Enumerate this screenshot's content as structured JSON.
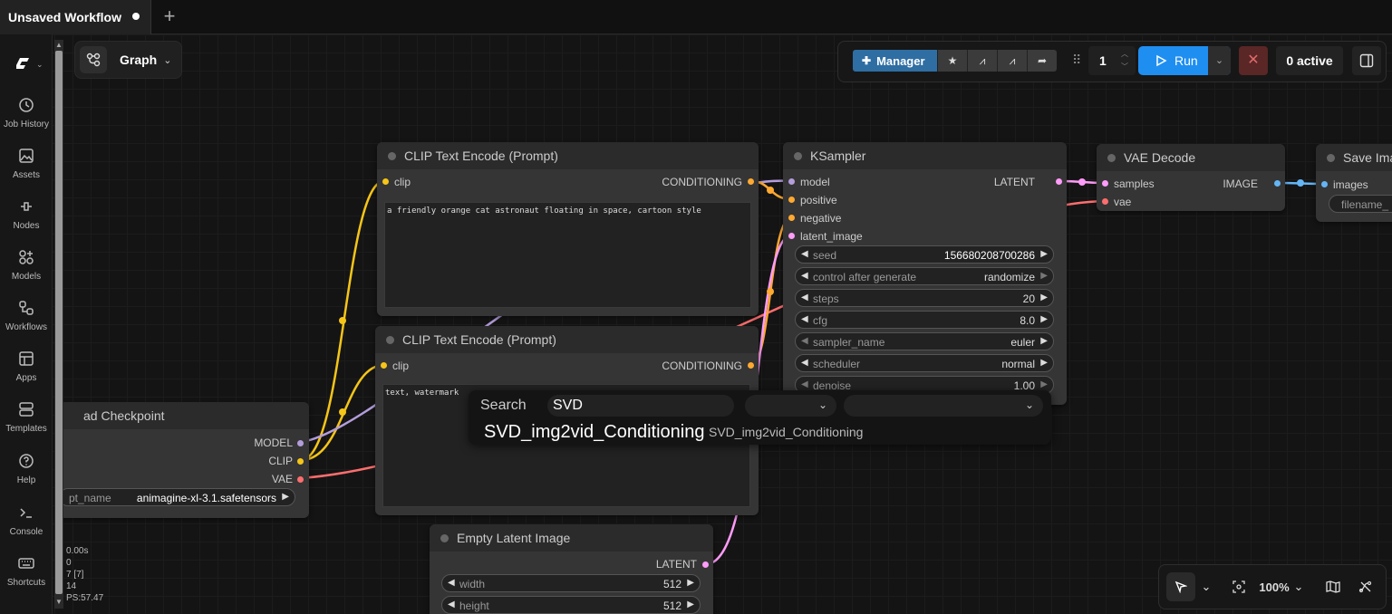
{
  "tab": {
    "title": "Unsaved Workflow"
  },
  "sidebar": {
    "items": [
      {
        "label": "Job History",
        "icon": "history-icon"
      },
      {
        "label": "Assets",
        "icon": "image-icon"
      },
      {
        "label": "Nodes",
        "icon": "nodes-icon"
      },
      {
        "label": "Models",
        "icon": "models-icon"
      },
      {
        "label": "Workflows",
        "icon": "workflows-icon"
      },
      {
        "label": "Apps",
        "icon": "apps-icon"
      },
      {
        "label": "Templates",
        "icon": "templates-icon"
      },
      {
        "label": "Help",
        "icon": "help-icon"
      },
      {
        "label": "Console",
        "icon": "terminal-icon"
      },
      {
        "label": "Shortcuts",
        "icon": "keyboard-icon"
      }
    ]
  },
  "graph": {
    "label": "Graph"
  },
  "toolbar": {
    "manager_label": "Manager",
    "queue_count": "1",
    "run_label": "Run",
    "active_label": "0 active"
  },
  "nodes": {
    "clip1": {
      "title": "CLIP Text Encode (Prompt)",
      "in_clip": "clip",
      "out": "CONDITIONING",
      "text": "a friendly orange cat astronaut floating in space, cartoon style"
    },
    "clip2": {
      "title": "CLIP Text Encode (Prompt)",
      "in_clip": "clip",
      "out": "CONDITIONING",
      "text": "text, watermark"
    },
    "ksampler": {
      "title": "KSampler",
      "inputs": [
        "model",
        "positive",
        "negative",
        "latent_image"
      ],
      "out": "LATENT",
      "widgets": [
        {
          "label": "seed",
          "value": "156680208700286"
        },
        {
          "label": "control after generate",
          "value": "randomize"
        },
        {
          "label": "steps",
          "value": "20"
        },
        {
          "label": "cfg",
          "value": "8.0"
        },
        {
          "label": "sampler_name",
          "value": "euler"
        },
        {
          "label": "scheduler",
          "value": "normal"
        },
        {
          "label": "denoise",
          "value": "1.00"
        }
      ]
    },
    "vae": {
      "title": "VAE Decode",
      "in_samples": "samples",
      "in_vae": "vae",
      "out": "IMAGE"
    },
    "save": {
      "title": "Save Ima",
      "in_images": "images",
      "widget": "filename_"
    },
    "checkpoint": {
      "title": "ad Checkpoint",
      "out_model": "MODEL",
      "out_clip": "CLIP",
      "out_vae": "VAE",
      "widget_label": "pt_name",
      "widget_value": "animagine-xl-3.1.safetensors"
    },
    "latent": {
      "title": "Empty Latent Image",
      "out": "LATENT",
      "widgets": [
        {
          "label": "width",
          "value": "512"
        },
        {
          "label": "height",
          "value": "512"
        }
      ]
    }
  },
  "search": {
    "label": "Search",
    "query": "SVD",
    "result_name": "SVD_img2vid_Conditioning",
    "result_id": "SVD_img2vid_Conditioning"
  },
  "stats": {
    "lines": [
      "0.00s",
      "0",
      "7 [7]",
      "14",
      "PS:57.47"
    ]
  },
  "bottom": {
    "zoom": "100%"
  },
  "colors": {
    "clip": "#f5c518",
    "model": "#b39ddb",
    "conditioning": "#ffa931",
    "latent": "#ff9cf9",
    "vae": "#ff6e6e",
    "image": "#64b5f6",
    "run": "#1f8ef1",
    "manager": "#2f6ea3"
  }
}
